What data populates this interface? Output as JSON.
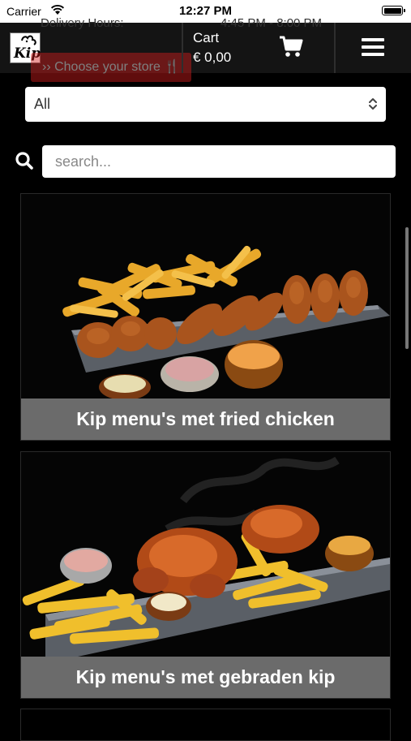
{
  "status_bar": {
    "carrier": "Carrier",
    "time": "12:27 PM"
  },
  "header": {
    "logo_text": "Kip",
    "ghost_delivery": "Delivery Hours:",
    "ghost_hours": "4:45 PM - 8:00 PM",
    "choose_store": "›› Choose your store 🍴",
    "cart_label": "Cart",
    "cart_total": "€ 0,00",
    "cart_icon": "shopping-cart-icon",
    "menu_icon": "hamburger-menu-icon"
  },
  "filter": {
    "selected": "All"
  },
  "search": {
    "placeholder": "search...",
    "icon": "search-icon"
  },
  "categories": [
    {
      "title": "Kip menu's met fried chicken"
    },
    {
      "title": "Kip menu's met gebraden kip"
    }
  ],
  "colors": {
    "background": "#000000",
    "header": "#141414",
    "caption": "#6b6b6b",
    "choose_store": "#d41e1e"
  }
}
